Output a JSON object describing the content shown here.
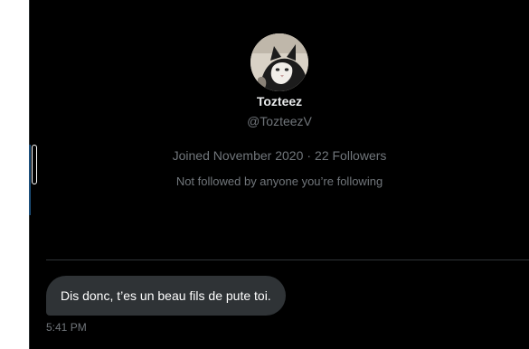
{
  "profile": {
    "display_name": "Tozteez",
    "handle": "@TozteezV",
    "joined": "Joined November 2020",
    "separator": "·",
    "followers": "22 Followers",
    "follow_note": "Not followed by anyone you’re following"
  },
  "conversation": {
    "message_text": "Dis donc, t’es un beau fils de pute toi.",
    "timestamp": "5:41 PM"
  },
  "colors": {
    "background": "#000000",
    "primary_text": "#e7e9ea",
    "secondary_text": "#71767b",
    "bubble": "#2f3336",
    "divider": "#2f3336"
  }
}
